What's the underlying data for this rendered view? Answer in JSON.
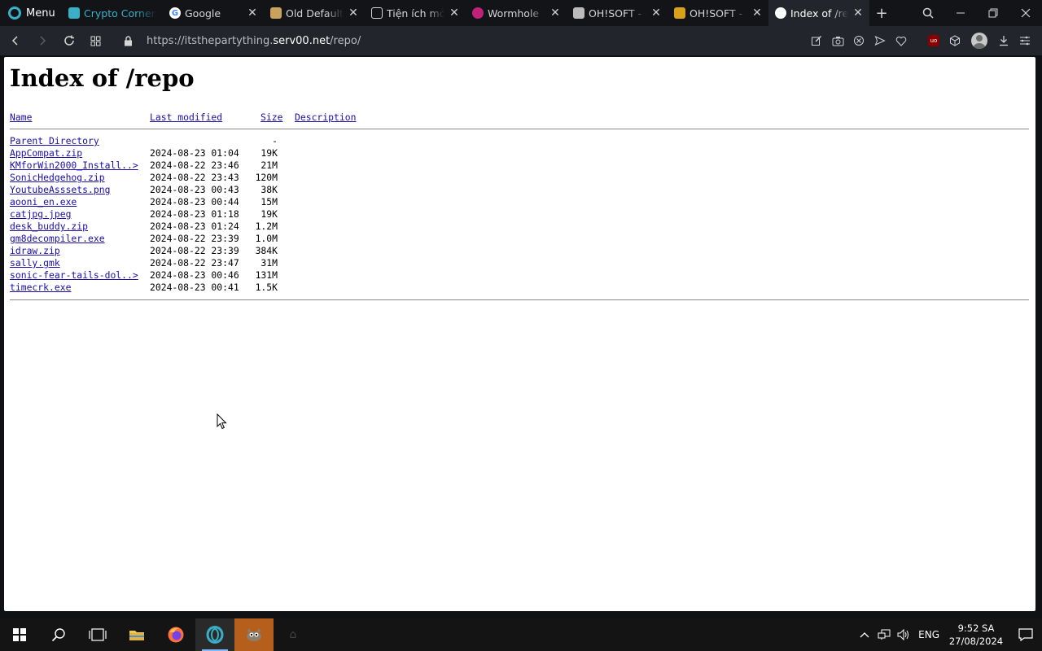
{
  "browser": {
    "menu_label": "Menu",
    "tabs": [
      {
        "label": "Crypto Corner",
        "icon": "crypto-icon",
        "color": "#3ab0c8"
      },
      {
        "label": "Google",
        "icon": "google-icon"
      },
      {
        "label": "Old Default",
        "icon": "old-default-icon"
      },
      {
        "label": "Tiện ích mở rộng",
        "icon": "cube-icon"
      },
      {
        "label": "Wormhole",
        "icon": "wormhole-icon"
      },
      {
        "label": "OH!SOFT - d",
        "icon": "chat-icon"
      },
      {
        "label": "OH!SOFT - D",
        "icon": "ohsoft-icon"
      },
      {
        "label": "Index of /repo",
        "icon": "globe-icon",
        "active": true
      }
    ],
    "url_prefix": "https://itsthepartything.",
    "url_host": "serv00.net",
    "url_suffix": "/repo/"
  },
  "page": {
    "title": "Index of /repo",
    "columns": {
      "name": "Name",
      "modified": "Last modified",
      "size": "Size",
      "description": "Description"
    },
    "parent": {
      "name": "Parent Directory",
      "size": "-"
    },
    "files": [
      {
        "name": "AppCompat.zip",
        "modified": "2024-08-23 01:04",
        "size": "19K"
      },
      {
        "name": "KMforWin2000_Install..>",
        "modified": "2024-08-22 23:46",
        "size": "21M"
      },
      {
        "name": "SonicHedgehog.zip",
        "modified": "2024-08-22 23:43",
        "size": "120M"
      },
      {
        "name": "YoutubeAsssets.png",
        "modified": "2024-08-23 00:43",
        "size": "38K"
      },
      {
        "name": "aooni_en.exe",
        "modified": "2024-08-23 00:44",
        "size": "15M"
      },
      {
        "name": "catjpg.jpeg",
        "modified": "2024-08-23 01:18",
        "size": "19K"
      },
      {
        "name": "desk_buddy.zip",
        "modified": "2024-08-23 01:24",
        "size": "1.2M"
      },
      {
        "name": "gm8decompiler.exe",
        "modified": "2024-08-22 23:39",
        "size": "1.0M"
      },
      {
        "name": "idraw.zip",
        "modified": "2024-08-22 23:39",
        "size": "384K"
      },
      {
        "name": "sally.gmk",
        "modified": "2024-08-22 23:47",
        "size": "31M"
      },
      {
        "name": "sonic-fear-tails-dol..>",
        "modified": "2024-08-23 00:46",
        "size": "131M"
      },
      {
        "name": "timecrk.exe",
        "modified": "2024-08-23 00:41",
        "size": "1.5K"
      }
    ]
  },
  "taskbar": {
    "language": "ENG",
    "time": "9:52 SA",
    "date": "27/08/2024"
  }
}
